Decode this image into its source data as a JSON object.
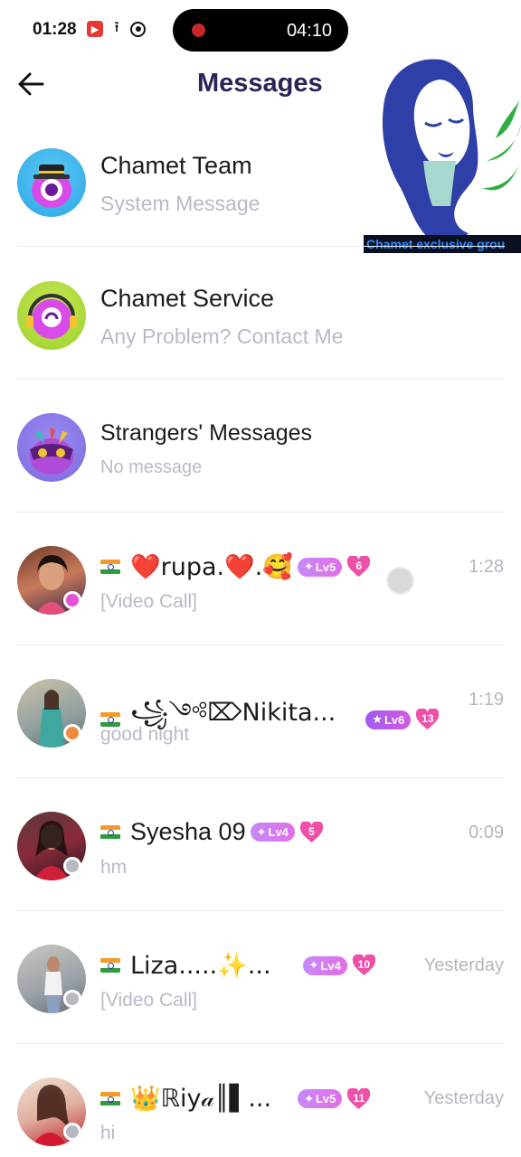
{
  "status_bar": {
    "time": "01:28",
    "recording_time": "04:10",
    "icons": [
      "record-app-icon",
      "upload-icon",
      "camera-icon"
    ]
  },
  "header": {
    "title": "Messages",
    "back_icon": "arrow-left-icon"
  },
  "overlay": {
    "caption": "Chamet exclusive grou"
  },
  "system_threads": [
    {
      "name": "Chamet Team",
      "subtitle": "System Message",
      "icon": "owl-hat-avatar"
    },
    {
      "name": "Chamet Service",
      "subtitle": "Any Problem? Contact Me",
      "icon": "headset-avatar"
    },
    {
      "name": "Strangers' Messages",
      "subtitle": "No message",
      "icon": "masked-avatar"
    }
  ],
  "conversations": [
    {
      "flag": "india-flag",
      "name": "❤️rupa.❤️.🥰",
      "level": "Lv5",
      "hearts": "6",
      "last_message": "[Video Call]",
      "time": "1:28",
      "status": "online",
      "status_color": "#e64fd8"
    },
    {
      "flag": "india-flag",
      "name": "꧁༺⌦Nikita...",
      "level": "Lv6",
      "hearts": "13",
      "last_message": "good night",
      "time": "1:19",
      "status": "busy",
      "status_color": "#f08a3c"
    },
    {
      "flag": "india-flag",
      "name": "Syesha 09",
      "level": "Lv4",
      "hearts": "5",
      "last_message": "hm",
      "time": "0:09",
      "status": "offline",
      "status_color": "#b8b8c0"
    },
    {
      "flag": "india-flag",
      "name": "Liza.....✨...",
      "level": "Lv4",
      "hearts": "10",
      "last_message": "[Video Call]",
      "time": "Yesterday",
      "status": "offline",
      "status_color": "#b8b8c0"
    },
    {
      "flag": "india-flag",
      "name": "👑ℝiy𝒶║▌...",
      "level": "Lv5",
      "hearts": "11",
      "last_message": "hi",
      "time": "Yesterday",
      "status": "offline",
      "status_color": "#b8b8c0"
    }
  ],
  "colors": {
    "title": "#2a2558",
    "subtitle": "#b9b9c8",
    "badge": "#d46ce9",
    "heart": "#ee4fa7"
  }
}
